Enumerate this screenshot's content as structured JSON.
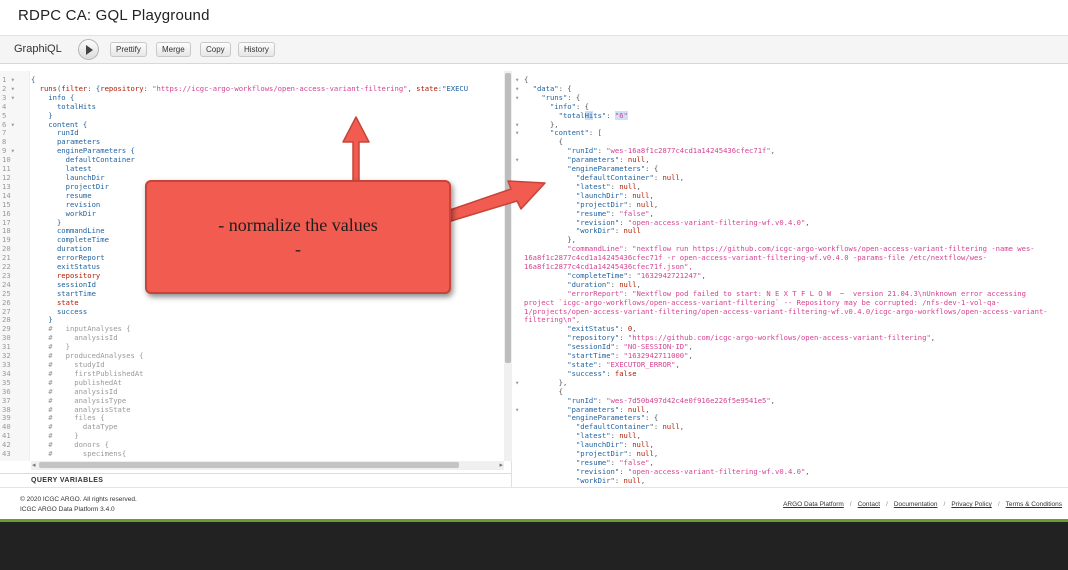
{
  "window": {
    "title": "RDPC CA: GQL Playground"
  },
  "toolbar": {
    "brand": "GraphiQL",
    "run_icon": "play-icon",
    "buttons": [
      "Prettify",
      "Merge",
      "Copy",
      "History"
    ]
  },
  "query_editor": {
    "line_numbers": "1 ▾\n2 ▾\n3 ▾\n4\n5\n6 ▾\n7\n8\n9 ▾\n10\n11\n12\n13\n14\n15\n16\n17\n18\n19\n20\n21\n22\n23\n24\n25\n26\n27\n28\n29\n30\n31\n32\n33\n34\n35\n36\n37\n38\n39\n40\n41\n42\n43",
    "lines": [
      "{",
      "  runs(filter: {repository: \"https://icgc-argo-workflows/open-access-variant-filtering\", state:\"EXECU",
      "    info {",
      "      totalHits",
      "    }",
      "    content {",
      "      runId",
      "      parameters",
      "      engineParameters {",
      "        defaultContainer",
      "        latest",
      "        launchDir",
      "        projectDir",
      "        resume",
      "        revision",
      "        workDir",
      "      }",
      "      commandLine",
      "      completeTime",
      "      duration",
      "      errorReport",
      "      exitStatus",
      "      repository",
      "      sessionId",
      "      startTime",
      "      state",
      "      success",
      "    }",
      "    #   inputAnalyses {",
      "    #     analysisId",
      "    #   }",
      "    #   producedAnalyses {",
      "    #     studyId",
      "    #     firstPublishedAt",
      "    #     publishedAt",
      "    #     analysisId",
      "    #     analysisType",
      "    #     analysisState",
      "    #     files {",
      "    #       dataType",
      "    #     }",
      "    #     donors {",
      "    #       specimens{"
    ],
    "query_variables_label": "QUERY VARIABLES"
  },
  "result": {
    "gutter": "▾\n▾\n▾\n\n\n▾\n▾\n\n\n▾\n\n\n\n\n\n\n\n\n\n\n\n\n\n\n\n\n\n\n\n\n\n\n\n\n▾\n\n\n▾",
    "lines": [
      "{",
      "  \"data\": {",
      "    \"runs\": {",
      "      \"info\": {",
      "        \"totalHits\": \"6\"",
      "      },",
      "      \"content\": [",
      "        {",
      "          \"runId\": \"wes-16a8f1c2877c4cd1a14245436cfec71f\",",
      "          \"parameters\": null,",
      "          \"engineParameters\": {",
      "            \"defaultContainer\": null,",
      "            \"latest\": null,",
      "            \"launchDir\": null,",
      "            \"projectDir\": null,",
      "            \"resume\": \"false\",",
      "            \"revision\": \"open-access-variant-filtering-wf.v0.4.0\",",
      "            \"workDir\": null",
      "          },",
      "          \"commandLine\": \"nextflow run https://github.com/icgc-argo-workflows/open-access-variant-filtering -name wes-",
      "16a8f1c2877c4cd1a14245436cfec71f -r open-access-variant-filtering-wf.v0.4.0 -params-file /etc/nextflow/wes-",
      "16a8f1c2877c4cd1a14245436cfec71f.json\",",
      "          \"completeTime\": \"1632942721247\",",
      "          \"duration\": null,",
      "          \"errorReport\": \"Nextflow pod failed to start: N E X T F L O W  ~  version 21.04.3\\nUnknown error accessing",
      "project `icgc-argo-workflows/open-access-variant-filtering` -- Repository may be corrupted: /nfs-dev-1-vol-qa-",
      "1/projects/open-access-variant-filtering/open-access-variant-filtering-wf.v0.4.0/icgc-argo-workflows/open-access-variant-",
      "filtering\\n\",",
      "          \"exitStatus\": 0,",
      "          \"repository\": \"https://github.com/icgc-argo-workflows/open-access-variant-filtering\",",
      "          \"sessionId\": \"NO-SESSION-ID\",",
      "          \"startTime\": \"1632942711000\",",
      "          \"state\": \"EXECUTOR_ERROR\",",
      "          \"success\": false",
      "        },",
      "        {",
      "          \"runId\": \"wes-7d50b497d42c4e0f916e226f5e9541e5\",",
      "          \"parameters\": null,",
      "          \"engineParameters\": {",
      "            \"defaultContainer\": null,",
      "            \"latest\": null,",
      "            \"launchDir\": null,",
      "            \"projectDir\": null,",
      "            \"resume\": \"false\",",
      "            \"revision\": \"open-access-variant-filtering-wf.v0.4.0\",",
      "            \"workDir\": null,"
    ]
  },
  "callout": {
    "line1": "- normalize the values",
    "line2": "-"
  },
  "footer": {
    "copyright": "© 2020 ICGC ARGO. All rights reserved.",
    "version": "ICGC ARGO Data Platform 3.4.0",
    "links": [
      "ARGO Data Platform",
      "Contact",
      "Documentation",
      "Privacy Policy",
      "Terms & Conditions"
    ]
  },
  "colors": {
    "callout": "#f25b4f",
    "accent_green": "#6a9c2f",
    "string": "#d64292",
    "property": "#1f61a0"
  }
}
